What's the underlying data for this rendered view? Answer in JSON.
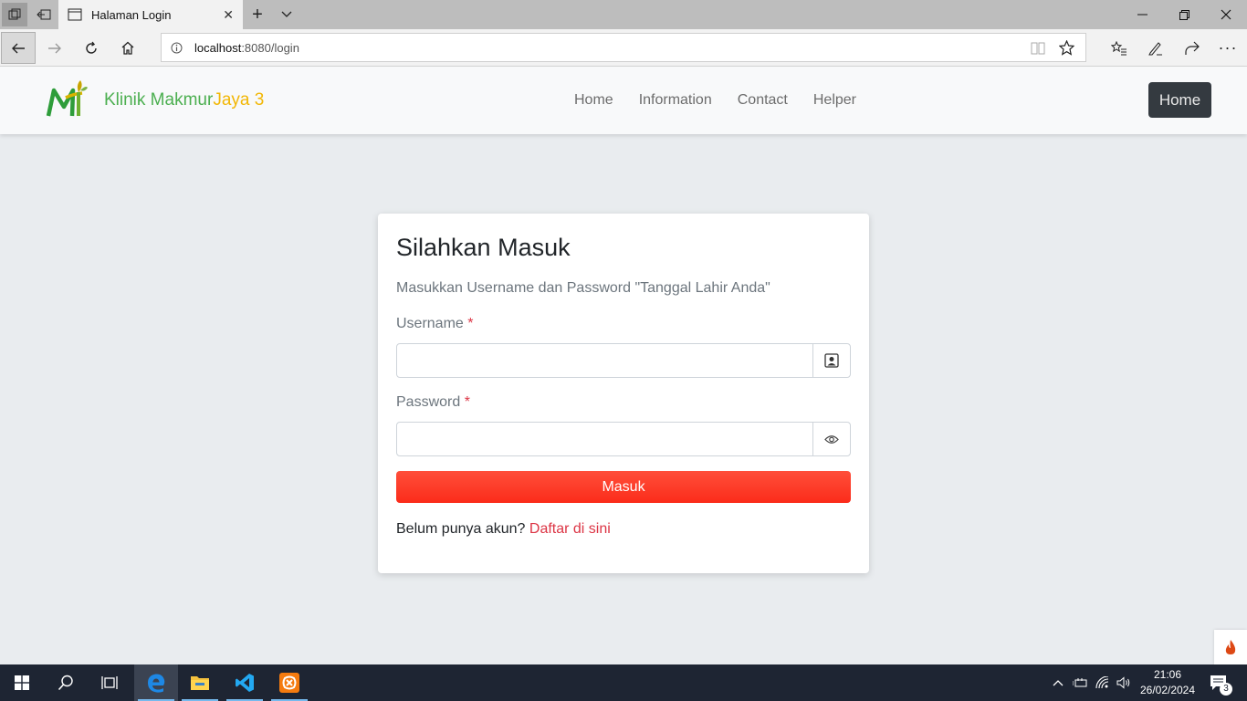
{
  "browser": {
    "tab_title": "Halaman Login",
    "url_host": "localhost",
    "url_rest": ":8080/login"
  },
  "navbar": {
    "brand_primary": "Klinik Makmur",
    "brand_secondary": "Jaya 3",
    "menu": [
      "Home",
      "Information",
      "Contact",
      "Helper"
    ],
    "button_label": "Home"
  },
  "login": {
    "title": "Silahkan Masuk",
    "subtitle": "Masukkan Username dan Password \"Tanggal Lahir Anda\"",
    "username_label": "Username",
    "password_label": "Password",
    "required_mark": "*",
    "username_value": "",
    "password_value": "",
    "submit_label": "Masuk",
    "register_text": "Belum punya akun?",
    "register_link": "Daftar di sini"
  },
  "taskbar": {
    "time": "21:06",
    "date": "26/02/2024",
    "notification_count": "3"
  },
  "colors": {
    "brand_green": "#4caf50",
    "brand_gold": "#f2b705",
    "submit_red": "#fb2b1a",
    "link_red": "#dc3545",
    "navbar_dark_button": "#343a40",
    "taskbar": "#1e2533"
  }
}
